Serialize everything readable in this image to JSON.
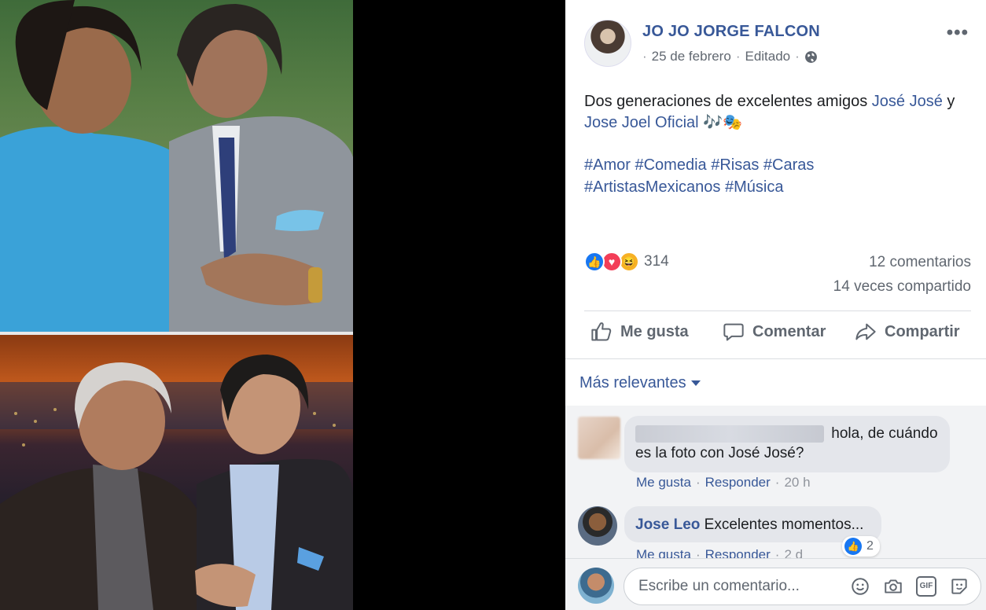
{
  "post": {
    "author": "JO JO JORGE FALCON",
    "date": "25 de febrero",
    "edited": "Editado",
    "separator": "·",
    "text_before": "Dos generaciones de excelentes amigos",
    "mention_1": "José José",
    "text_join": "y",
    "mention_2": "Jose Joel Oficial",
    "text_emoji": "🎶🎭",
    "hashtags": [
      "#Amor",
      "#Comedia",
      "#Risas",
      "#Caras",
      "#ArtistasMexicanos",
      "#Música"
    ]
  },
  "stats": {
    "reaction_count": "314",
    "comments": "12 comentarios",
    "shares": "14 veces compartido",
    "reaction_icons": [
      "like-icon",
      "love-icon",
      "haha-icon"
    ]
  },
  "actions": {
    "like": "Me gusta",
    "comment": "Comentar",
    "share": "Compartir"
  },
  "comments_sort": "Más relevantes",
  "comments": [
    {
      "text_line1": "hola, de cuándo",
      "text_line2": "es la foto con José José?",
      "like": "Me gusta",
      "reply": "Responder",
      "time": "20 h"
    },
    {
      "author": "Jose Leo",
      "text": "Excelentes momentos...",
      "like": "Me gusta",
      "reply": "Responder",
      "time": "2 d",
      "like_count": "2"
    }
  ],
  "composer": {
    "placeholder": "Escribe un comentario...",
    "gif_label": "GIF"
  },
  "colors": {
    "link": "#385898",
    "muted": "#606770",
    "bubble": "#e4e6eb",
    "like_blue": "#1877f2",
    "love_red": "#f33e58",
    "haha_yellow": "#f7b125"
  }
}
